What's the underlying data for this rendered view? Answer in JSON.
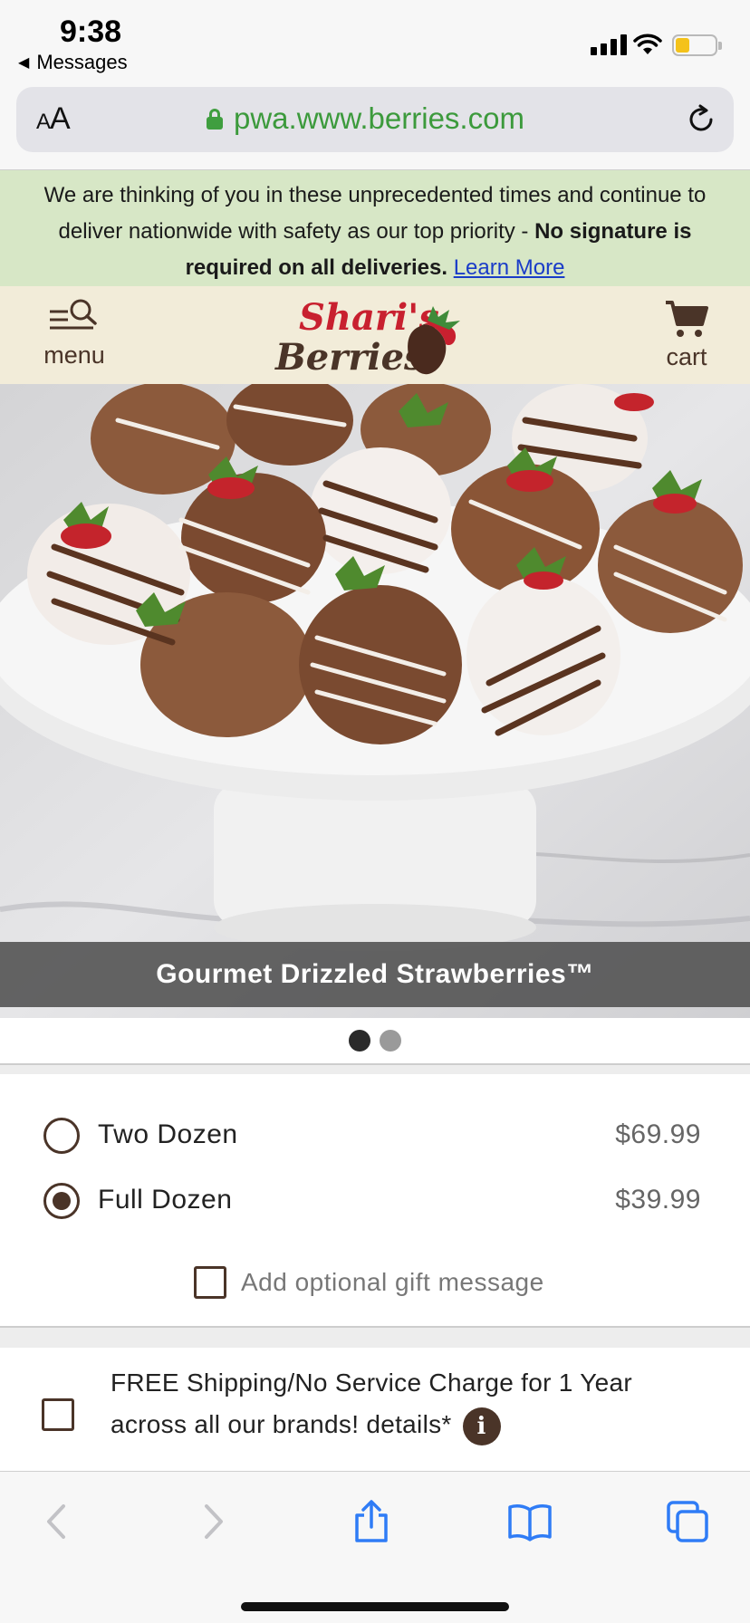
{
  "status_bar": {
    "time": "9:38",
    "back_label": "Messages",
    "battery_level": 0.35,
    "signal_bars": 4
  },
  "browser": {
    "text_size_label": "AA",
    "url": "pwa.www.berries.com"
  },
  "banner": {
    "text": "We are thinking of you in these unprecedented times and continue to deliver nationwide with safety as our top priority - ",
    "bold_text": "No signature is required on all deliveries.",
    "link_text": "Learn More"
  },
  "header": {
    "menu_label": "menu",
    "cart_label": "cart",
    "logo_line1": "Shari's",
    "logo_line2": "Berries"
  },
  "product": {
    "title": "Gourmet Drizzled Strawberries™",
    "carousel": {
      "total": 2,
      "active": 1
    },
    "options": [
      {
        "label": "Two Dozen",
        "price": "$69.99",
        "selected": false
      },
      {
        "label": "Full Dozen",
        "price": "$39.99",
        "selected": true
      }
    ],
    "gift_message_label": "Add optional gift message"
  },
  "shipping": {
    "text": "FREE Shipping/No Service Charge for 1 Year across all our brands! details*",
    "info_icon": "i"
  },
  "icons": {
    "back": "chevron-left-icon",
    "forward": "chevron-right-icon",
    "share": "share-icon",
    "bookmarks": "book-icon",
    "tabs": "tabs-icon",
    "cart": "cart-icon",
    "menu": "menu-search-icon"
  },
  "colors": {
    "brand_brown": "#4a3428",
    "banner_bg": "#d7e7c6",
    "header_bg": "#f2ecd9",
    "url_green": "#3c9a3c",
    "logo_red": "#c8202f",
    "ios_blue": "#2f7cf6"
  }
}
